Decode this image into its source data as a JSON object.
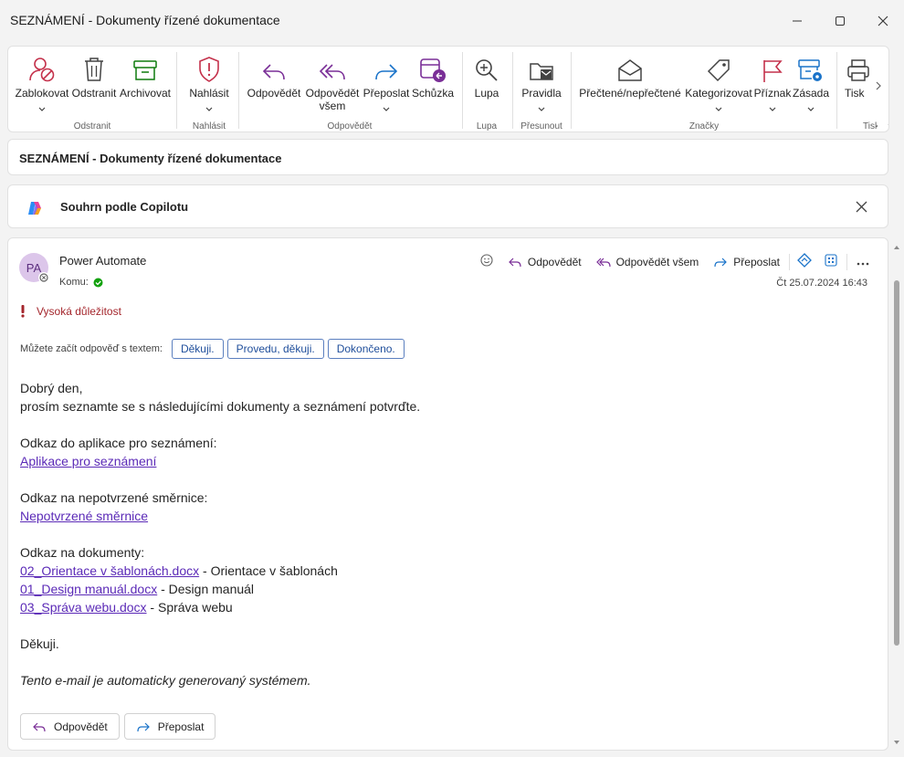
{
  "window": {
    "title": "SEZNÁMENÍ - Dokumenty řízené dokumentace"
  },
  "ribbon": {
    "buttons": {
      "block": "Zablokovat",
      "delete": "Odstranit",
      "archive": "Archivovat",
      "report": "Nahlásit",
      "reply": "Odpovědět",
      "reply_all_1": "Odpovědět",
      "reply_all_2": "všem",
      "forward": "Přeposlat",
      "meeting": "Schůzka",
      "zoom": "Lupa",
      "rules": "Pravidla",
      "read_unread": "Přečtené/nepřečtené",
      "categorize": "Kategorizovat",
      "flag": "Příznak",
      "policy": "Zásada",
      "print": "Tisk"
    },
    "groups": {
      "delete": "Odstranit",
      "report": "Nahlásit",
      "respond": "Odpovědět",
      "zoom": "Lupa",
      "move": "Přesunout",
      "tags": "Značky",
      "print": "Tisk"
    }
  },
  "subject": "SEZNÁMENÍ - Dokumenty řízené dokumentace",
  "copilot": {
    "label": "Souhrn podle Copilotu"
  },
  "message": {
    "avatar_initials": "PA",
    "sender": "Power Automate",
    "to_label": "Komu:",
    "date": "Čt 25.07.2024 16:43",
    "actions": {
      "reply": "Odpovědět",
      "reply_all": "Odpovědět všem",
      "forward": "Přeposlat"
    },
    "importance": "Vysoká důležitost",
    "quick_reply_label": "Můžete začít odpověď s textem:",
    "quick_replies": [
      "Děkuji.",
      "Provedu, děkuji.",
      "Dokončeno."
    ],
    "body": {
      "greeting": "Dobrý den,",
      "intro": "prosím seznamte se s následujícími dokumenty a seznámení potvrďte.",
      "app_label": "Odkaz do aplikace pro seznámení:",
      "app_link": "Aplikace pro seznámení",
      "dir_label": "Odkaz na nepotvrzené směrnice:",
      "dir_link": "Nepotvrzené směrnice",
      "docs_label": "Odkaz na dokumenty:",
      "docs": [
        {
          "link": "02_Orientace v šablonách.docx",
          "desc": " - Orientace v šablonách"
        },
        {
          "link": "01_Design manuál.docx",
          "desc": " - Design manuál"
        },
        {
          "link": "03_Správa webu.docx",
          "desc": " - Správa webu"
        }
      ],
      "thanks": "Děkuji.",
      "footer": "Tento e-mail je automaticky generovaný systémem."
    },
    "bottom": {
      "reply": "Odpovědět",
      "forward": "Přeposlat"
    }
  }
}
